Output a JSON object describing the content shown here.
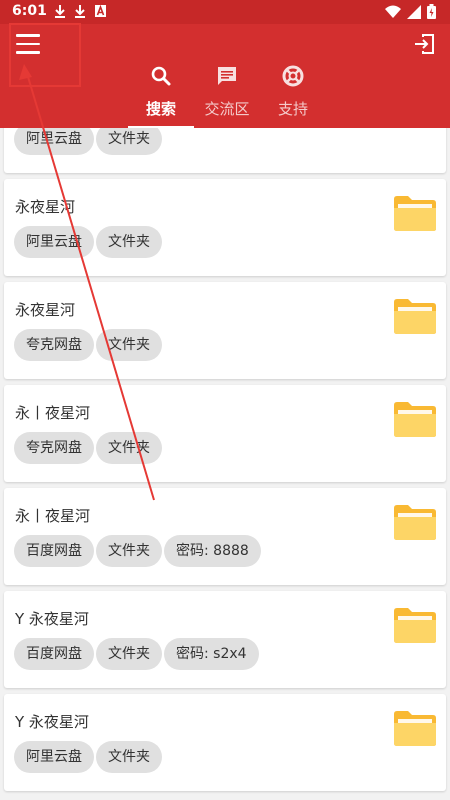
{
  "status_bar": {
    "time": "6:01",
    "left_icons": [
      "download-icon",
      "download-icon",
      "a-badge-icon"
    ],
    "right_icons": [
      "wifi-icon",
      "signal-icon",
      "battery-icon"
    ]
  },
  "header": {
    "color": "#d32f2f",
    "menu_icon": "menu-icon",
    "login_icon": "login-icon",
    "tabs": [
      {
        "label": "搜索",
        "icon": "search-icon",
        "active": true
      },
      {
        "label": "交流区",
        "icon": "chat-icon",
        "active": false
      },
      {
        "label": "支持",
        "icon": "lifebuoy-icon",
        "active": false
      }
    ]
  },
  "results": [
    {
      "title": "",
      "tags": [
        "阿里云盘",
        "文件夹"
      ],
      "icon": "folder-icon"
    },
    {
      "title": "永夜星河",
      "tags": [
        "阿里云盘",
        "文件夹"
      ],
      "icon": "folder-icon"
    },
    {
      "title": "永夜星河",
      "tags": [
        "夸克网盘",
        "文件夹"
      ],
      "icon": "folder-icon"
    },
    {
      "title": "永丨夜星河",
      "tags": [
        "夸克网盘",
        "文件夹"
      ],
      "icon": "folder-icon"
    },
    {
      "title": "永丨夜星河",
      "tags": [
        "百度网盘",
        "文件夹",
        "密码: 8888"
      ],
      "icon": "folder-icon"
    },
    {
      "title": "Y 永夜星河",
      "tags": [
        "百度网盘",
        "文件夹",
        "密码: s2x4"
      ],
      "icon": "folder-icon"
    },
    {
      "title": "Y 永夜星河",
      "tags": [
        "阿里云盘",
        "文件夹"
      ],
      "icon": "folder-icon"
    }
  ],
  "annotation": {
    "color": "#e53935"
  }
}
